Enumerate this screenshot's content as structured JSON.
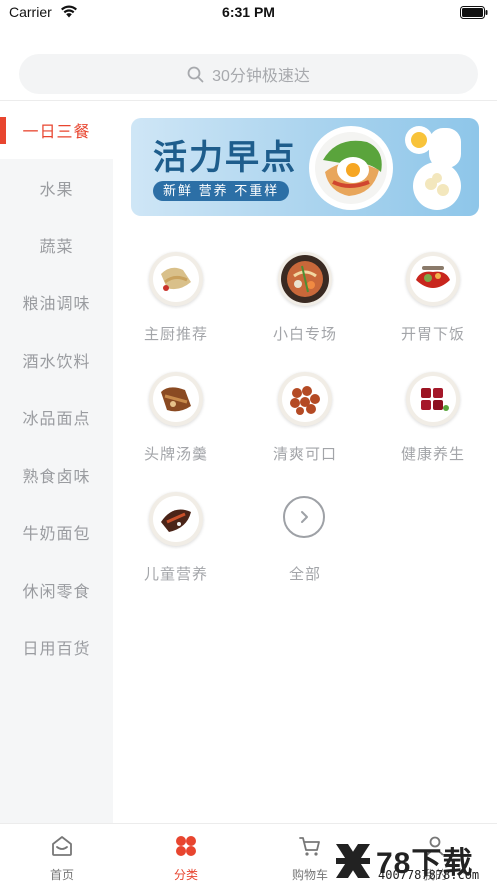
{
  "status_bar": {
    "carrier": "Carrier",
    "time": "6:31 PM"
  },
  "search": {
    "placeholder": "30分钟极速达",
    "icon": "search-icon"
  },
  "sidebar": {
    "active_color": "#e8452f",
    "items": [
      {
        "label": "一日三餐",
        "active": true
      },
      {
        "label": "水果",
        "active": false
      },
      {
        "label": "蔬菜",
        "active": false
      },
      {
        "label": "粮油调味",
        "active": false
      },
      {
        "label": "酒水饮料",
        "active": false
      },
      {
        "label": "冰品面点",
        "active": false
      },
      {
        "label": "熟食卤味",
        "active": false
      },
      {
        "label": "牛奶面包",
        "active": false
      },
      {
        "label": "休闲零食",
        "active": false
      },
      {
        "label": "日用百货",
        "active": false
      }
    ]
  },
  "banner": {
    "title": "活力早点",
    "subtitle": "新鲜 营养 不重样"
  },
  "categories": [
    {
      "label": "主厨推荐",
      "icon": "chef-dish-icon"
    },
    {
      "label": "小白专场",
      "icon": "noodle-bowl-icon"
    },
    {
      "label": "开胃下饭",
      "icon": "spicy-pot-icon"
    },
    {
      "label": "头牌汤羹",
      "icon": "soup-icon"
    },
    {
      "label": "清爽可口",
      "icon": "dumpling-plate-icon"
    },
    {
      "label": "健康养生",
      "icon": "braised-pork-icon"
    },
    {
      "label": "儿童营养",
      "icon": "fish-dish-icon"
    },
    {
      "label": "全部",
      "icon": "chevron-right-icon"
    }
  ],
  "tabbar": {
    "tabs": [
      {
        "label": "首页",
        "icon": "home-icon",
        "active": false
      },
      {
        "label": "分类",
        "icon": "category-icon",
        "active": true
      },
      {
        "label": "购物车",
        "icon": "cart-icon",
        "active": false
      },
      {
        "label": "我的",
        "icon": "user-icon",
        "active": false
      }
    ]
  },
  "watermark": {
    "brand": "78下载",
    "url": "4007787878.com"
  }
}
